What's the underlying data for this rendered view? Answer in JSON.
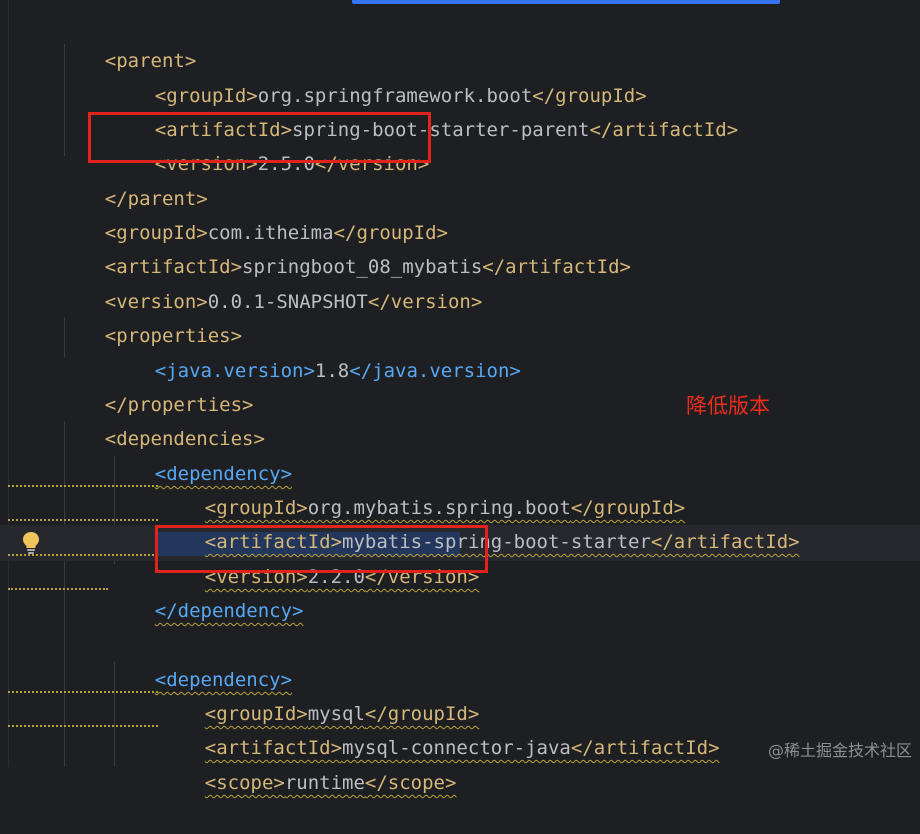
{
  "annotation": "降低版本",
  "watermark": "@稀土掘金技术社区",
  "colors": {
    "background": "#1e1f22",
    "tag": "#d5b778",
    "dependency_tag": "#56a8f5",
    "text": "#bcbec4",
    "highlight_box": "#e0231b",
    "annotation": "#ec2c1c",
    "scroll_indicator": "#3574f0"
  },
  "icons": {
    "intention": "lightbulb-icon"
  },
  "code": {
    "parent_open": "<parent>",
    "parent_group": {
      "open": "<groupId>",
      "value": "org.springframework.boot",
      "close": "</groupId>"
    },
    "parent_artifact": {
      "open": "<artifactId>",
      "value": "spring-boot-starter-parent",
      "close": "</artifactId>"
    },
    "parent_version": {
      "open": "<version>",
      "value": "2.5.0",
      "close": "</version>"
    },
    "parent_close": "</parent>",
    "group": {
      "open": "<groupId>",
      "value": "com.itheima",
      "close": "</groupId>"
    },
    "artifact": {
      "open": "<artifactId>",
      "value": "springboot_08_mybatis",
      "close": "</artifactId>"
    },
    "version": {
      "open": "<version>",
      "value": "0.0.1-SNAPSHOT",
      "close": "</version>"
    },
    "properties_open": "<properties>",
    "java_version": {
      "open": "<java.version>",
      "value": "1.8",
      "close": "</java.version>"
    },
    "properties_close": "</properties>",
    "dependencies_open": "<dependencies>",
    "dep1": {
      "open": "<dependency>",
      "group": {
        "open": "<groupId>",
        "value": "org.mybatis.spring.boot",
        "close": "</groupId>"
      },
      "artifact": {
        "open": "<artifactId>",
        "value": "mybatis-spring-boot-starter",
        "close": "</artifactId>"
      },
      "version": {
        "open": "<version>",
        "value": "2.2.0",
        "close": "</version>"
      },
      "close": "</dependency>"
    },
    "dep2": {
      "open": "<dependency>",
      "group": {
        "open": "<groupId>",
        "value": "mysql",
        "close": "</groupId>"
      },
      "artifact": {
        "open": "<artifactId>",
        "value": "mysql-connector-java",
        "close": "</artifactId>"
      },
      "scope": {
        "open": "<scope>",
        "value": "runtime",
        "close": "</scope>"
      }
    }
  }
}
